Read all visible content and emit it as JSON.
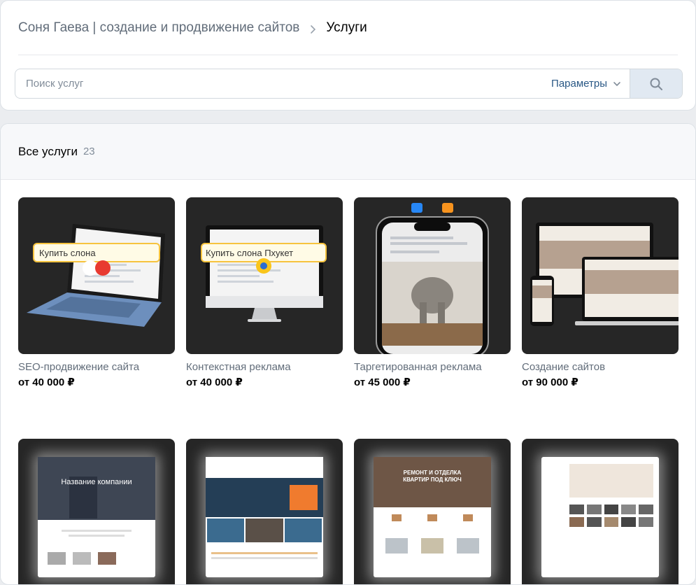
{
  "breadcrumb": {
    "group": "Соня Гаева | создание и продвижение сайтов",
    "current": "Услуги"
  },
  "search": {
    "placeholder": "Поиск услуг",
    "params_label": "Параметры"
  },
  "section": {
    "title": "Все услуги",
    "count": "23"
  },
  "thumb_text": {
    "seo_search": "Купить слона",
    "ppc_search": "Купить слона Пхукет",
    "site_hero": "Название компании",
    "renovation_banner": "РЕМОНТ И ОТДЕЛКА КВАРТИР ПОД КЛЮЧ"
  },
  "services": [
    {
      "title": "SEO-продвижение сайта",
      "price": "от 40 000 ₽"
    },
    {
      "title": "Контекстная реклама",
      "price": "от 40 000 ₽"
    },
    {
      "title": "Таргетированная реклама",
      "price": "от 45 000 ₽"
    },
    {
      "title": "Создание сайтов",
      "price": "от 90 000 ₽"
    },
    {
      "title": "",
      "price": ""
    },
    {
      "title": "",
      "price": ""
    },
    {
      "title": "",
      "price": ""
    },
    {
      "title": "",
      "price": ""
    }
  ],
  "colors": {
    "link": "#2a5885",
    "muted": "#626d7a",
    "thumb_bg": "#262626",
    "search_btn": "#e1e9f2"
  }
}
